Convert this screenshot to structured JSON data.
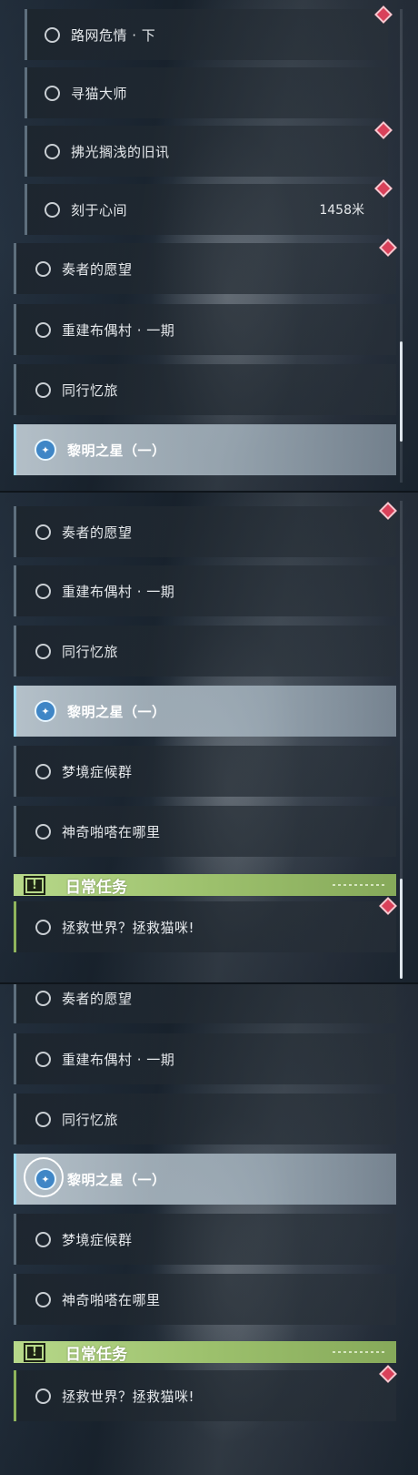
{
  "panel1": {
    "quests": [
      {
        "label": "路网危情 · 下"
      },
      {
        "label": "寻猫大师"
      },
      {
        "label": "拂光搁浅的旧讯"
      },
      {
        "label": "刻于心间",
        "distance": "1458米"
      },
      {
        "label": "奏者的愿望"
      },
      {
        "label": "重建布偶村 · 一期"
      },
      {
        "label": "同行忆旅"
      },
      {
        "label": "黎明之星（一）",
        "active": true
      }
    ]
  },
  "panel2": {
    "quests": [
      {
        "label": "奏者的愿望"
      },
      {
        "label": "重建布偶村 · 一期"
      },
      {
        "label": "同行忆旅"
      },
      {
        "label": "黎明之星（一）",
        "active": true
      },
      {
        "label": "梦境症候群"
      },
      {
        "label": "神奇啪嗒在哪里"
      }
    ],
    "section_title": "日常任务",
    "daily": [
      {
        "label": "拯救世界？拯救猫咪!"
      }
    ]
  },
  "panel3": {
    "quests": [
      {
        "label": "奏者的愿望"
      },
      {
        "label": "重建布偶村 · 一期"
      },
      {
        "label": "同行忆旅"
      },
      {
        "label": "黎明之星（一）",
        "active": true
      },
      {
        "label": "梦境症候群"
      },
      {
        "label": "神奇啪嗒在哪里"
      }
    ],
    "section_title": "日常任务",
    "daily": [
      {
        "label": "拯救世界？拯救猫咪!"
      }
    ]
  },
  "icons": {
    "untracked": "circle-icon",
    "tracked": "tracking-star-icon",
    "new_marker": "red-diamond-icon",
    "section": "exclamation-icon"
  },
  "colors": {
    "active_border": "#9fe0ff",
    "new_marker": "#d9415a",
    "daily_section": "#b7d88a",
    "tracked_icon": "#3f86c6"
  }
}
